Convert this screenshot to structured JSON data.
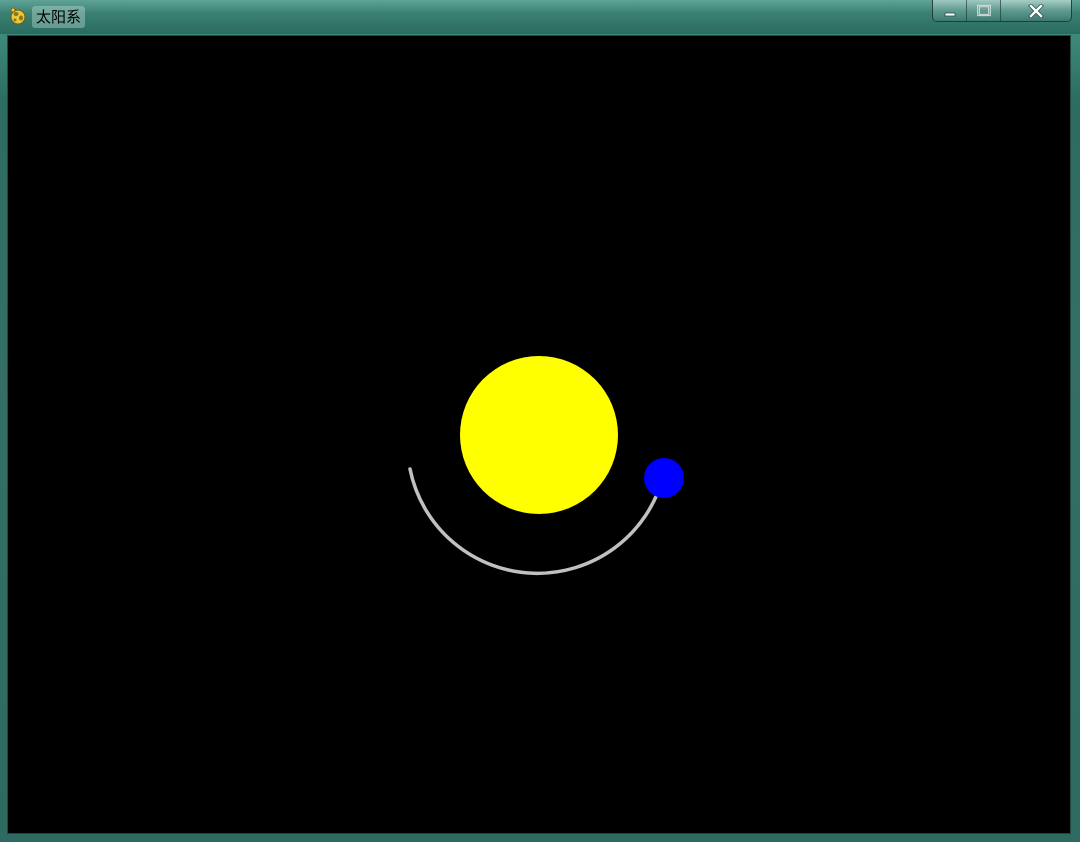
{
  "window": {
    "title": "太阳系",
    "app_icon": "pygame-snake-icon",
    "buttons": {
      "minimize_icon": "minimize-icon",
      "maximize_icon": "maximize-icon",
      "close_icon": "close-icon"
    }
  },
  "scene": {
    "background_color": "#000000",
    "sun": {
      "color": "#ffff00"
    },
    "planet": {
      "color": "#0000ff"
    },
    "trail": {
      "color": "#c0c0c0"
    }
  }
}
